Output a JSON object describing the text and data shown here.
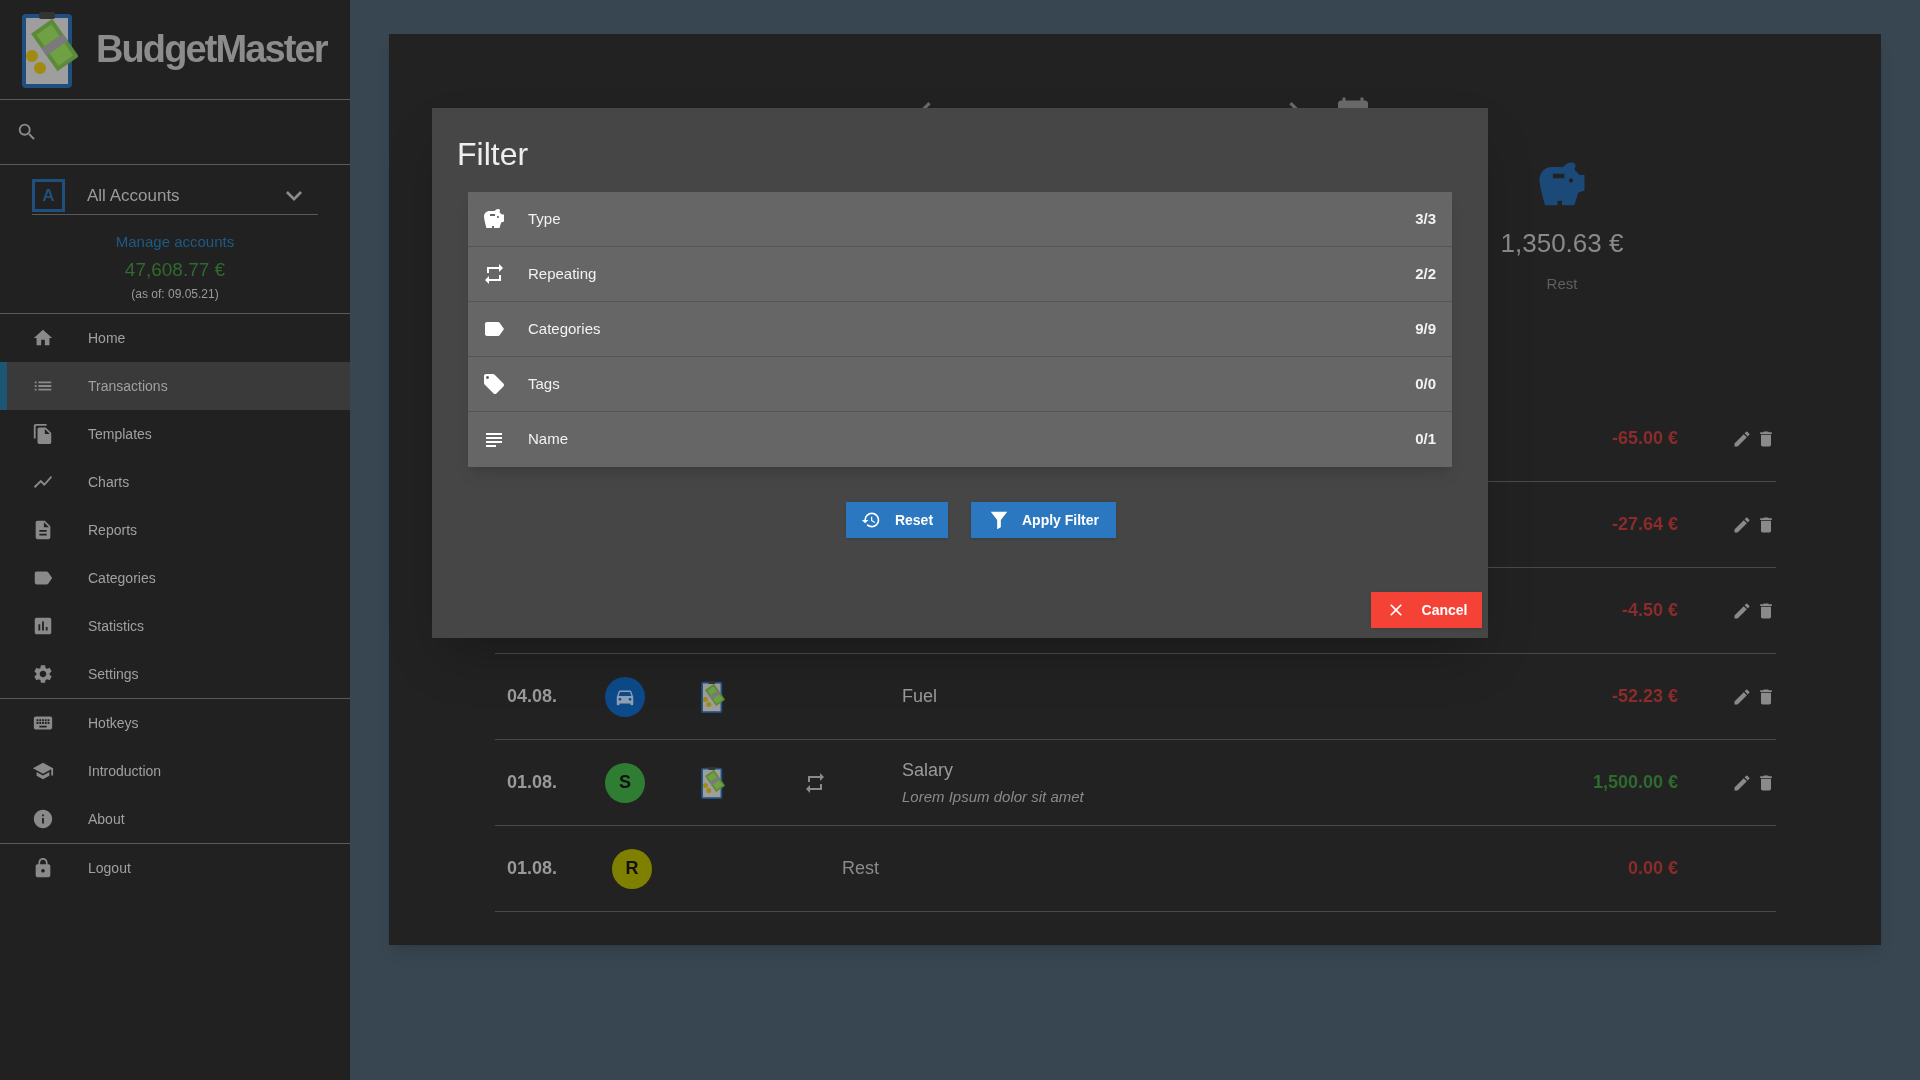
{
  "sidebar": {
    "app_name": "BudgetMaster",
    "account": {
      "badge": "A",
      "name": "All Accounts"
    },
    "manage_link": "Manage accounts",
    "balance": "47,608.77 €",
    "balance_date": "(as of: 09.05.21)",
    "nav_groups": [
      [
        {
          "label": "Home",
          "selected": false
        },
        {
          "label": "Transactions",
          "selected": true
        },
        {
          "label": "Templates",
          "selected": false
        },
        {
          "label": "Charts",
          "selected": false
        },
        {
          "label": "Reports",
          "selected": false
        },
        {
          "label": "Categories",
          "selected": false
        },
        {
          "label": "Statistics",
          "selected": false
        },
        {
          "label": "Settings",
          "selected": false
        }
      ],
      [
        {
          "label": "Hotkeys",
          "selected": false
        },
        {
          "label": "Introduction",
          "selected": false
        },
        {
          "label": "About",
          "selected": false
        }
      ],
      [
        {
          "label": "Logout",
          "selected": false
        }
      ]
    ]
  },
  "summary": {
    "amount": "1,350.63 €",
    "label": "Rest"
  },
  "transactions": [
    {
      "kind": "transaction",
      "amount": "-65.00 €",
      "positive": false
    },
    {
      "kind": "transaction",
      "amount": "-27.64 €",
      "positive": false
    },
    {
      "kind": "transaction",
      "amount": "-4.50 €",
      "positive": false
    },
    {
      "kind": "transaction",
      "date": "04.08.",
      "category": {
        "color": "#0d4a8a"
      },
      "name": "Fuel",
      "repeating": false,
      "amount": "-52.23 €",
      "positive": false
    },
    {
      "kind": "transaction",
      "date": "01.08.",
      "category": {
        "letter": "S",
        "color": "#2e7d32"
      },
      "name": "Salary",
      "description": "Lorem Ipsum dolor sit amet",
      "repeating": true,
      "amount": "1,500.00 €",
      "positive": true
    },
    {
      "kind": "rest",
      "date": "01.08.",
      "category": {
        "letter": "R",
        "color": "#808000"
      },
      "name": "Rest",
      "amount": "0.00 €",
      "positive": false
    }
  ],
  "filter_dialog": {
    "title": "Filter",
    "rows": [
      {
        "label": "Type",
        "count": "3/3"
      },
      {
        "label": "Repeating",
        "count": "2/2"
      },
      {
        "label": "Categories",
        "count": "9/9"
      },
      {
        "label": "Tags",
        "count": "0/0"
      },
      {
        "label": "Name",
        "count": "0/1"
      }
    ],
    "reset_button": "Reset",
    "apply_button": "Apply Filter",
    "cancel_button": "Cancel"
  }
}
